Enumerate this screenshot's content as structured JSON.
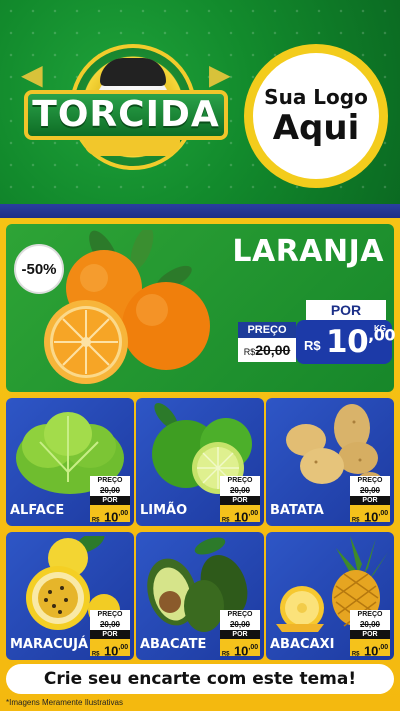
{
  "header": {
    "brand_word": "TORCIDA",
    "logo_placeholder": {
      "line1": "Sua Logo",
      "line2": "Aqui"
    }
  },
  "featured": {
    "discount": "-50%",
    "name": "LARANJA",
    "old_label": "PREÇO",
    "old_currency": "R$",
    "old_price": "20,00",
    "por_label": "POR",
    "currency": "R$",
    "price_int": "10",
    "price_cents": ",00",
    "unit": "KG"
  },
  "products": [
    {
      "name": "ALFACE",
      "old_label": "PREÇO",
      "old_price": "20,00",
      "por": "POR",
      "currency": "R$",
      "price_int": "10",
      "price_cents": ",00"
    },
    {
      "name": "LIMÃO",
      "old_label": "PREÇO",
      "old_price": "20,00",
      "por": "POR",
      "currency": "R$",
      "price_int": "10",
      "price_cents": ",00"
    },
    {
      "name": "BATATA",
      "old_label": "PREÇO",
      "old_price": "20,00",
      "por": "POR",
      "currency": "R$",
      "price_int": "10",
      "price_cents": ",00"
    },
    {
      "name": "MARACUJÁ",
      "old_label": "PREÇO",
      "old_price": "20,00",
      "por": "POR",
      "currency": "R$",
      "price_int": "10",
      "price_cents": ",00"
    },
    {
      "name": "ABACATE",
      "old_label": "PREÇO",
      "old_price": "20,00",
      "por": "POR",
      "currency": "R$",
      "price_int": "10",
      "price_cents": ",00"
    },
    {
      "name": "ABACAXI",
      "old_label": "PREÇO",
      "old_price": "20,00",
      "por": "POR",
      "currency": "R$",
      "price_int": "10",
      "price_cents": ",00"
    }
  ],
  "footer": {
    "cta": "Crie seu encarte com este tema!",
    "disclaimer": "*Imagens Meramente Ilustrativas"
  },
  "colors": {
    "header_green": "#128a2c",
    "accent_yellow": "#f4b90f",
    "card_blue": "#1d3aa0",
    "price_blue": "#1c3aa8"
  }
}
